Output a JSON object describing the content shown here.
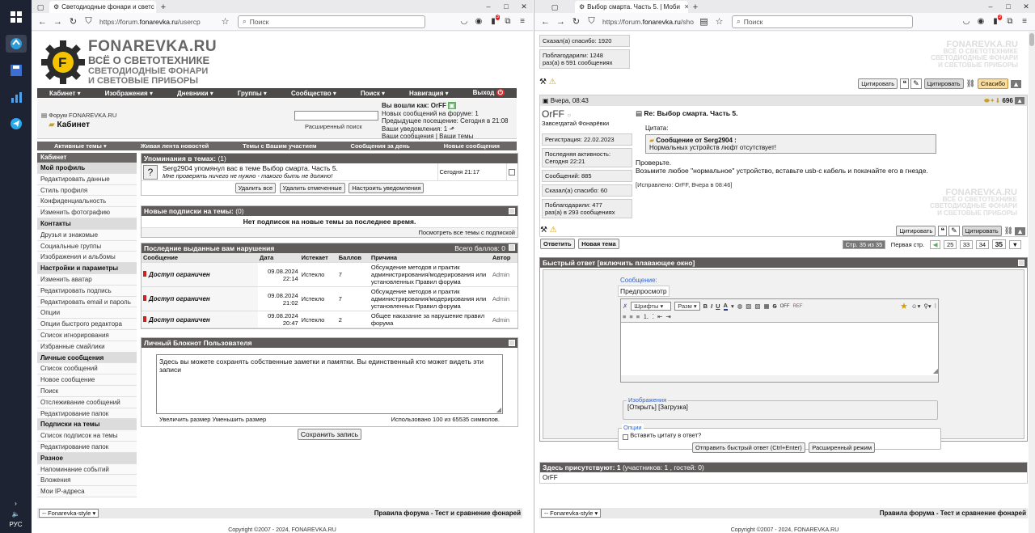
{
  "taskbar": {
    "lang": "РУС"
  },
  "left": {
    "tab_title": "Светодиодные фонари и светс",
    "url_pre": "https://forum.",
    "url_host": "fonarevka.ru",
    "url_post": "/usercp",
    "search_placeholder": "Поиск",
    "badge": "3",
    "logo": {
      "t1": "FONAREVKA.RU",
      "t2": "ВСЁ О СВЕТОТЕХНИКЕ",
      "t3a": "СВЕТОДИОДНЫЕ ФОНАРИ",
      "t3b": "И СВЕТОВЫЕ ПРИБОРЫ"
    },
    "menu": [
      "Кабинет ▾",
      "Изображения ▾",
      "Дневники ▾",
      "Группы ▾",
      "Сообщество ▾",
      "Поиск ▾",
      "Навигация ▾",
      "Выход"
    ],
    "breadcrumb": "Форум FONAREVKA.RU",
    "page_title": "Кабинет",
    "adv_search": "Расширенный поиск",
    "login": {
      "l1": "Вы вошли как: OrFF",
      "l2": "Новых сообщений на форуме: 1",
      "l3": "Предыдущее посещение: Сегодня в 21:08",
      "l4": "Ваши уведомления: 1",
      "l5a": "Ваши сообщения",
      "l5b": "Ваши темы"
    },
    "subnav": [
      "Активные темы ▾",
      "Живая лента новостей",
      "Темы с Вашим участием",
      "Сообщения за день",
      "Новые сообщения"
    ],
    "sidebar": [
      {
        "label": "Кабинет",
        "type": "head"
      },
      {
        "label": "Мой профиль",
        "type": "h"
      },
      {
        "label": "Редактировать данные"
      },
      {
        "label": "Стиль профиля"
      },
      {
        "label": "Конфиденциальность"
      },
      {
        "label": "Изменить фотографию"
      },
      {
        "label": "Контакты",
        "type": "h"
      },
      {
        "label": "Друзья и знакомые"
      },
      {
        "label": "Социальные группы"
      },
      {
        "label": "Изображения и альбомы"
      },
      {
        "label": "Настройки и параметры",
        "type": "h"
      },
      {
        "label": "Изменить аватар"
      },
      {
        "label": "Редактировать подпись"
      },
      {
        "label": "Редактировать email и пароль"
      },
      {
        "label": "Опции"
      },
      {
        "label": "Опции быстрого редактора"
      },
      {
        "label": "Список игнорирования"
      },
      {
        "label": "Избранные смайлики"
      },
      {
        "label": "Личные сообщения",
        "type": "h"
      },
      {
        "label": "Список сообщений"
      },
      {
        "label": "Новое сообщение"
      },
      {
        "label": "Поиск"
      },
      {
        "label": "Отслеживание сообщений"
      },
      {
        "label": "Редактирование папок"
      },
      {
        "label": "Подписки на темы",
        "type": "h"
      },
      {
        "label": "Список подписок на темы"
      },
      {
        "label": "Редактирование папок"
      },
      {
        "label": "Разное",
        "type": "h"
      },
      {
        "label": "Напоминание событий"
      },
      {
        "label": "Вложения"
      },
      {
        "label": "Мои IP-адреса"
      }
    ],
    "mentions": {
      "title": "Упоминания в темах:",
      "count": "(1)",
      "line1": "Serg2904 упомянул вас в теме Выбор смарта. Часть 5.",
      "line2": "Мне проверять ничего не нужно - такого быть не должно!",
      "time": "Сегодня 21:17",
      "btn1": "Удалить все",
      "btn2": "Удалить отмеченные",
      "btn3": "Настроить уведомления"
    },
    "subs": {
      "title": "Новые подписки на темы:",
      "count": "(0)",
      "empty": "Нет подписок на новые темы за последнее время.",
      "link": "Посмотреть все темы с подпиской"
    },
    "warn": {
      "title": "Последние выданные вам нарушения",
      "total": "Всего баллов: 0",
      "cols": [
        "Сообщение",
        "Дата",
        "Истекает",
        "Баллов",
        "Причина",
        "Автор"
      ],
      "rows": [
        {
          "msg": "Доступ ограничен",
          "d1": "09.08.2024",
          "d2": "22:14",
          "exp": "Истекло",
          "pts": "7",
          "reason": "Обсуждение методов и практик администрирования/модерирования или установленных Правил форума",
          "author": "Admin"
        },
        {
          "msg": "Доступ ограничен",
          "d1": "09.08.2024",
          "d2": "21:02",
          "exp": "Истекло",
          "pts": "7",
          "reason": "Обсуждение методов и практик администрирования/модерирования или установленных Правил форума",
          "author": "Admin"
        },
        {
          "msg": "Доступ ограничен",
          "d1": "09.08.2024",
          "d2": "20:47",
          "exp": "Истекло",
          "pts": "2",
          "reason": "Общее наказание за нарушение правил форума",
          "author": "Admin"
        }
      ]
    },
    "notepad": {
      "title": "Личный Блокнот Пользователя",
      "text": "Здесь вы можете сохранять собственные заметки и памятки. Вы единственный кто может видеть эти записи",
      "enlarge": "Увеличить размер",
      "shrink": "Уменьшить размер",
      "used": "Использовано 100 из 65535 символов.",
      "save": "Сохранить запись"
    },
    "style_select": "-- Fonarevka-style",
    "rules": "Правила форума - Тест и сравнение фонарей",
    "copyright": "Copyright ©2007 - 2024, FONAREVKA.RU"
  },
  "right": {
    "tab_title": "Выбор смарта. Часть 5. | Моби",
    "url_pre": "https://forum.",
    "url_host": "fonarevka.ru",
    "url_post": "/sho",
    "search_placeholder": "Поиск",
    "badge": "3",
    "prev": {
      "thanks": "Сказал(а) спасибо: 1920",
      "thanked1": "Поблагодарили: 1248",
      "thanked2": "раз(а) в 591 сообщениях"
    },
    "btns": {
      "quote": "Цитировать",
      "cite": "Цитировать",
      "thanks": "Спасибо"
    },
    "post": {
      "date": "Вчера, 08:43",
      "num": "696",
      "user": "OrFF",
      "rank": "Завсегдатай Фонарёвки",
      "reg": "Регистрация: 22.02.2023",
      "act1": "Последняя активность:",
      "act2": "Сегодня 22:21",
      "msgs": "Сообщений: 885",
      "thanks": "Сказал(а) спасибо: 60",
      "thanked1": "Поблагодарили: 477",
      "thanked2": "раз(а) в 293 сообщениях",
      "title": "Re: Выбор смарта. Часть 5.",
      "quote_lbl": "Цитата:",
      "quote_from": "Сообщение от Serg2904 :",
      "quote_text": "Нормальных устройств люфт отсутствует!",
      "p1": "Проверьте.",
      "p2": "Возьмите любое \"нормальное\" устройство, вставьте usb-c кабель и покачайте его в гнезде.",
      "edit": "[Исправлено: OrFF, Вчера в 08:46]"
    },
    "wm": {
      "t1": "FONAREVKA.RU",
      "t2": "ВСЁ О СВЕТОТЕХНИКЕ",
      "t3": "СВЕТОДИОДНЫЕ ФОНАРИ",
      "t4": "И СВЕТОВЫЕ ПРИБОРЫ"
    },
    "reply": "Ответить",
    "newtopic": "Новая тема",
    "pages": {
      "label": "Стр. 35 из 35",
      "first": "Первая стр.",
      "nums": [
        "25",
        "33",
        "34",
        "35"
      ]
    },
    "quick": {
      "title": "Быстрый ответ [включить плавающее окно]",
      "msg_lbl": "Сообщение:",
      "preview": "Предпросмотр",
      "fonts": "Шрифты",
      "size": "Разм",
      "images_lbl": "Изображения",
      "images": "[Открыть] [Загрузка]",
      "opts_lbl": "Опции",
      "opt1": "Вставить цитату в ответ?",
      "send": "Отправить быстрый ответ (Ctrl+Enter)",
      "adv": "Расширенный режим"
    },
    "present": {
      "title": "Здесь присутствуют: 1",
      "detail": "(участников: 1 , гостей: 0)",
      "user": "OrFF"
    },
    "style_select": "-- Fonarevka-style",
    "rules": "Правила форума - Тест и сравнение фонарей",
    "copyright": "Copyright ©2007 - 2024, FONAREVKA.RU"
  }
}
